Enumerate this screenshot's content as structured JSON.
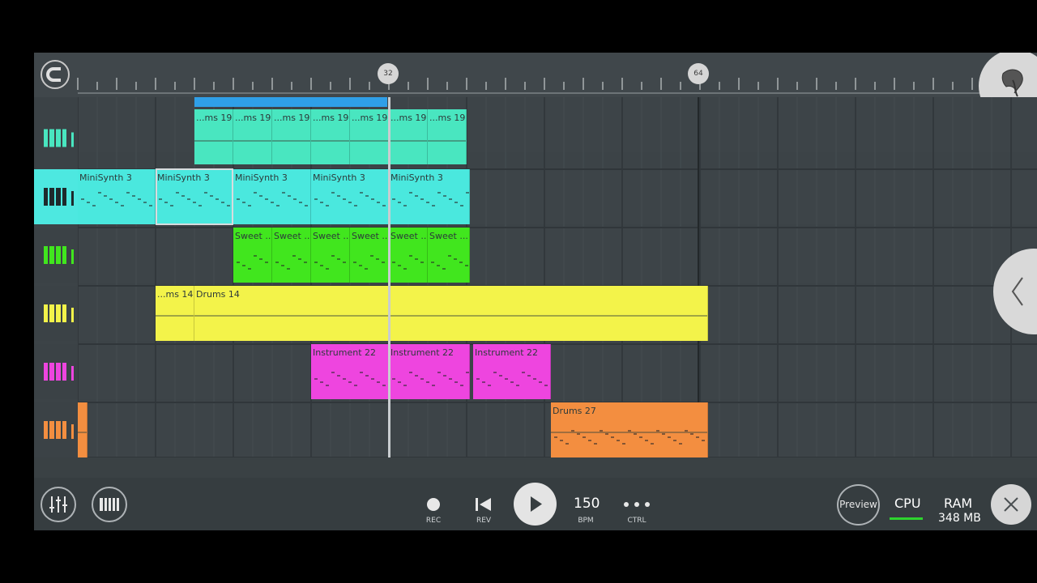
{
  "ruler": {
    "markers": [
      "32",
      "64"
    ]
  },
  "tracks": [
    {
      "color": "#49e6c0",
      "clips": [
        {
          "label": "...ms 19"
        },
        {
          "label": "...ms 19"
        },
        {
          "label": "...ms 19"
        },
        {
          "label": "...ms 19"
        },
        {
          "label": "...ms 19"
        },
        {
          "label": "...ms 19"
        },
        {
          "label": "...ms 19"
        }
      ]
    },
    {
      "color": "#4ae8de",
      "clips": [
        {
          "label": "MiniSynth 3"
        },
        {
          "label": "MiniSynth 3"
        },
        {
          "label": "MiniSynth 3"
        },
        {
          "label": "MiniSynth 3"
        },
        {
          "label": "MiniSynth 3"
        }
      ]
    },
    {
      "color": "#41e61e",
      "clips": [
        {
          "label": "Sweet ..."
        },
        {
          "label": "Sweet ..."
        },
        {
          "label": "Sweet ..."
        },
        {
          "label": "Sweet ..."
        },
        {
          "label": "Sweet ..."
        },
        {
          "label": "Sweet ..."
        }
      ]
    },
    {
      "color": "#f3f34a",
      "clips": [
        {
          "label": "...ms 14"
        },
        {
          "label": "Drums 14"
        }
      ]
    },
    {
      "color": "#ee45df",
      "clips": [
        {
          "label": "Instrument 22"
        },
        {
          "label": "Instrument 22"
        },
        {
          "label": "Instrument 22"
        }
      ]
    },
    {
      "color": "#f38e40",
      "clips": [
        {
          "label": ""
        },
        {
          "label": "Drums 27"
        }
      ]
    }
  ],
  "transport": {
    "rec_label": "REC",
    "rev_label": "REV",
    "bpm_value": "150",
    "bpm_label": "BPM",
    "ctrl_label": "CTRL",
    "preview_label": "Preview",
    "cpu_label": "CPU",
    "ram_label": "RAM",
    "ram_value": "348 MB"
  },
  "icons": {
    "magnet": "magnet-icon",
    "fl_logo": "fruit-logo-icon",
    "mixer": "mixer-icon",
    "piano": "piano-icon",
    "record": "record-icon",
    "rewind": "rewind-icon",
    "play": "play-icon",
    "ctrl": "dots-icon",
    "close": "close-icon",
    "collapse": "chevron-left-icon"
  }
}
